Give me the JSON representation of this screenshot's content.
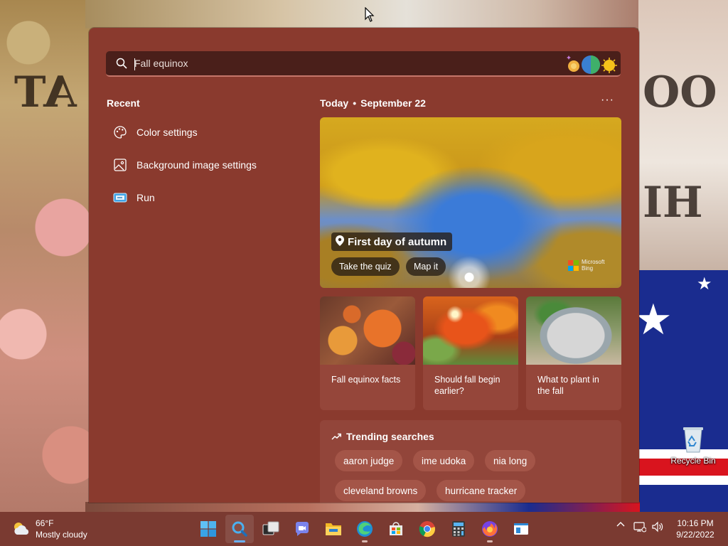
{
  "search": {
    "value": "Fall equinox",
    "placeholder": "Fall equinox"
  },
  "recent": {
    "title": "Recent",
    "items": [
      {
        "label": "Color settings",
        "icon": "palette-icon"
      },
      {
        "label": "Background image settings",
        "icon": "image-icon"
      },
      {
        "label": "Run",
        "icon": "run-icon"
      }
    ]
  },
  "today": {
    "label": "Today",
    "date": "September 22",
    "more": "···"
  },
  "hero": {
    "title": "First day of autumn",
    "buttons": [
      "Take the quiz",
      "Map it"
    ],
    "attribution_line1": "Microsoft",
    "attribution_line2": "Bing"
  },
  "cards": [
    {
      "caption": "Fall equinox facts"
    },
    {
      "caption": "Should fall begin earlier?"
    },
    {
      "caption": "What to plant in the fall"
    }
  ],
  "trending": {
    "title": "Trending searches",
    "items": [
      "aaron judge",
      "ime udoka",
      "nia long",
      "cleveland browns",
      "hurricane tracker"
    ]
  },
  "desktop": {
    "recycle_bin_label": "Recycle Bin"
  },
  "taskbar": {
    "weather_temp": "66°F",
    "weather_desc": "Mostly cloudy",
    "apps": [
      "start",
      "search",
      "task-view",
      "chat",
      "file-explorer",
      "edge",
      "store",
      "chrome",
      "calculator",
      "firefox",
      "notepad"
    ],
    "time": "10:16 PM",
    "date": "9/22/2022"
  },
  "colors": {
    "panel": "#8a3a2e",
    "searchbox": "#4a1f1a",
    "taskbar": "#7a3a31",
    "accent": "#c5766a"
  }
}
